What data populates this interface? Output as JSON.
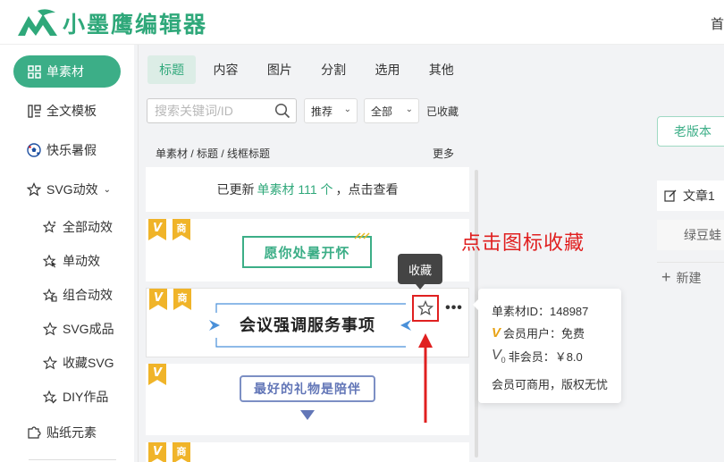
{
  "header": {
    "logo_text": "小墨鹰编辑器",
    "home_link": "首"
  },
  "sidebar": {
    "items": [
      {
        "label": "单素材",
        "icon": "grid-icon"
      },
      {
        "label": "全文模板",
        "icon": "layout-icon"
      },
      {
        "label": "快乐暑假",
        "icon": "soccer-ball-icon"
      },
      {
        "label": "SVG动效",
        "icon": "star-outline-icon"
      }
    ],
    "sub_items": [
      {
        "label": "全部动效",
        "icon": "sparkle-star-icon"
      },
      {
        "label": "单动效",
        "icon": "cursor-star-icon"
      },
      {
        "label": "组合动效",
        "icon": "layers-star-icon"
      },
      {
        "label": "SVG成品",
        "icon": "star-outline-icon"
      },
      {
        "label": "收藏SVG",
        "icon": "star-outline-icon"
      },
      {
        "label": "DIY作品",
        "icon": "edit-star-icon"
      }
    ],
    "extra": {
      "label": "贴纸元素",
      "icon": "puzzle-icon"
    }
  },
  "panel": {
    "tabs": [
      "标题",
      "内容",
      "图片",
      "分割",
      "选用",
      "其他"
    ],
    "active_tab": "标题",
    "search_placeholder": "搜索关键词/ID",
    "sort_dropdown": "推荐",
    "scope_dropdown": "全部",
    "favorites_filter": "已收藏",
    "breadcrumb": "单素材 / 标题 / 线框标题",
    "more_link": "更多",
    "notice": {
      "prefix": "已更新",
      "highlight": "单素材 111 个",
      "suffix": "，点击查看"
    },
    "cards": [
      {
        "text": "愿你处暑开怀",
        "badges": [
          "V",
          "商"
        ]
      },
      {
        "text": "会议强调服务事项",
        "badges": [
          "V",
          "商"
        ]
      },
      {
        "text": "最好的礼物是陪伴",
        "badges": [
          "V"
        ]
      },
      {
        "text": "",
        "badges": [
          "V",
          "商"
        ]
      }
    ]
  },
  "tooltip": {
    "label": "收藏"
  },
  "info_popup": {
    "id_line": "单素材ID：148987",
    "vip_line": "会员用户：免费",
    "novip_line": "非会员：￥8.0",
    "license_line": "会员可商用，版权无忧"
  },
  "annotation": "点击图标收藏",
  "right_panel": {
    "old_version": "老版本",
    "doc_item": "文章1",
    "doc_item2": "绿豆蛙",
    "new_button": "新建"
  },
  "colors": {
    "brand": "#3cae87",
    "accent_red": "#e02020",
    "vip_gold": "#e8a317"
  }
}
